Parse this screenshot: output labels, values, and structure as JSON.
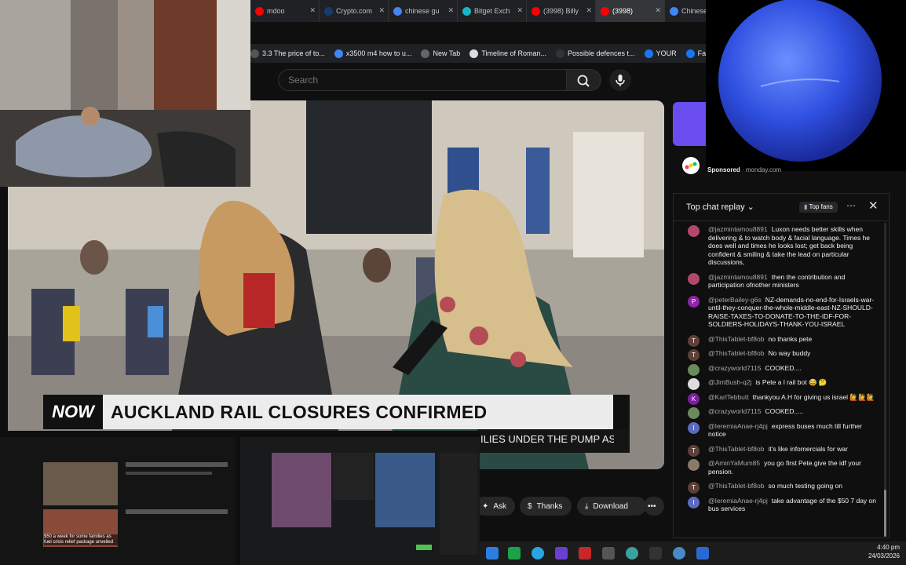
{
  "browser": {
    "tabs": [
      {
        "label": "mdoo",
        "favicon": "youtube-icon",
        "active": false
      },
      {
        "label": "Crypto.com",
        "favicon": "crypto-icon",
        "active": false
      },
      {
        "label": "chinese gu",
        "favicon": "google-icon",
        "active": false
      },
      {
        "label": "Bitget Exch",
        "favicon": "bitget-icon",
        "active": false
      },
      {
        "label": "(3998) Billy",
        "favicon": "youtube-icon",
        "active": false
      },
      {
        "label": "(3998)",
        "favicon": "youtube-icon",
        "active": true
      },
      {
        "label": "Chinese x",
        "favicon": "google-icon",
        "active": false
      }
    ],
    "bookmarks": [
      {
        "label": "3.3 The price of to...",
        "icon": "page-icon"
      },
      {
        "label": "x3500 m4 how to u...",
        "icon": "google-icon"
      },
      {
        "label": "New Tab",
        "icon": "newtab-icon"
      },
      {
        "label": "Timeline of Roman...",
        "icon": "wikipedia-icon"
      },
      {
        "label": "Possible defences t...",
        "icon": "cl-icon"
      },
      {
        "label": "YOUR",
        "icon": "facebook-icon"
      },
      {
        "label": "Facebook green",
        "icon": "facebook-icon"
      }
    ]
  },
  "youtube": {
    "search_placeholder": "Search",
    "video": {
      "logo": "NOW",
      "headline": "AUCKLAND RAIL CLOSURES CONFIRMED",
      "ticker": "ILIES UNDER THE PUMP AS"
    },
    "actions": {
      "ask": "Ask",
      "thanks": "Thanks",
      "download": "Download",
      "more": "•••"
    },
    "sponsor": {
      "label": "Sponsored",
      "source": "monday.com"
    },
    "chat": {
      "title": "Top chat replay",
      "filter": "Top fans",
      "messages": [
        {
          "initial": "",
          "color": "#b3476e",
          "author": "@jazmintamou8891",
          "text": "Luxon needs better skills when delivering & to watch body & facial language. Times he does well and times he looks lost; get back being confident & smiling & take the lead on particular discussions,"
        },
        {
          "initial": "",
          "color": "#b3476e",
          "author": "@jazmintamou8891",
          "text": "then the contribution and participation ofnother ministers"
        },
        {
          "initial": "P",
          "color": "#8e24aa",
          "author": "@peterBailey-g6s",
          "text": "NZ-demands-no-end-for-Israels-war-until-they-conquer-the-whole-middle-east-NZ-SHOULD-RAISE-TAXES-TO-DONATE-TO-THE-IDF-FOR-SOLDIERS-HOLIDAYS-THANK-YOU-ISRAEL"
        },
        {
          "initial": "T",
          "color": "#5d4037",
          "author": "@ThisTablet-bf8ob",
          "text": "no thanks pete"
        },
        {
          "initial": "T",
          "color": "#5d4037",
          "author": "@ThisTablet-bf8ob",
          "text": "No way buddy"
        },
        {
          "initial": "",
          "color": "#6a8a5a",
          "author": "@crazyworld7115",
          "text": "COOKED...."
        },
        {
          "initial": "",
          "color": "#dddddd",
          "author": "@JimBush-q2j",
          "text": "is Pete a l rail bot 😂 🤔"
        },
        {
          "initial": "K",
          "color": "#7b1fa2",
          "author": "@KarlTebbutt",
          "text": "thankyou A.H for giving us israel 🙋🙋🙋"
        },
        {
          "initial": "",
          "color": "#6a8a5a",
          "author": "@crazyworld7115",
          "text": "COOKED....."
        },
        {
          "initial": "I",
          "color": "#5c6bc0",
          "author": "@IeremiaAnae-rj4pj",
          "text": "express buses much till further notice"
        },
        {
          "initial": "T",
          "color": "#5d4037",
          "author": "@ThisTablet-bf8ob",
          "text": "it's like infomercials for war"
        },
        {
          "initial": "",
          "color": "#8a7a6a",
          "author": "@AminYaMum85",
          "text": "you go first Pete.give the idf your pension."
        },
        {
          "initial": "T",
          "color": "#5d4037",
          "author": "@ThisTablet-bf8ob",
          "text": "so much testing going on"
        },
        {
          "initial": "I",
          "color": "#5c6bc0",
          "author": "@IeremiaAnae-rj4pj",
          "text": "take advantage of the $50 7 day on bus services"
        }
      ]
    }
  },
  "thumbnails": {
    "left_caption": "$50 a week for some families as fuel crisis relief package unveiled"
  },
  "taskbar": {
    "time": "4:40 pm",
    "date": "24/03/2026"
  }
}
